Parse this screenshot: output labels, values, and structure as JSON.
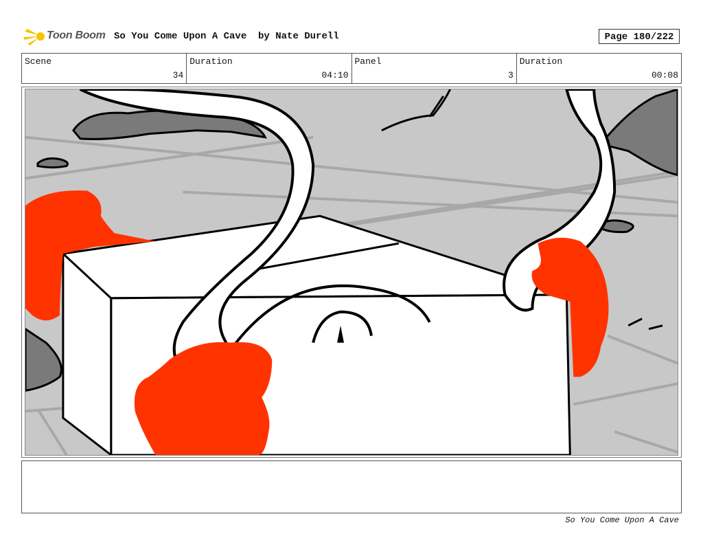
{
  "header": {
    "logo_text": "Toon Boom",
    "title": "So You Come Upon A Cave  by Nate Durell",
    "page": "Page 180/222"
  },
  "info": {
    "scene_label": "Scene",
    "scene_value": "34",
    "duration_label": "Duration",
    "duration_value": "04:10",
    "panel_label": "Panel",
    "panel_value": "3",
    "panel_duration_label": "Duration",
    "panel_duration_value": "00:08"
  },
  "notes": {
    "text": ""
  },
  "footer": {
    "text": "So You Come Upon A Cave"
  },
  "colors": {
    "floor": "#c8c8c8",
    "rock": "#7a7a7a",
    "flame": "#ff3300",
    "line": "#000000"
  }
}
